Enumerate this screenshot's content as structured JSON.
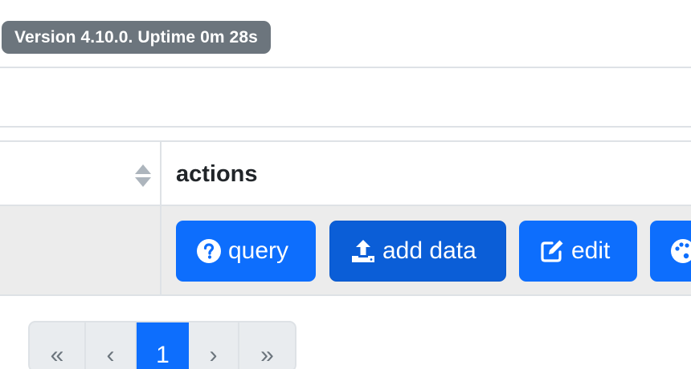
{
  "status": {
    "version_text": "Version 4.10.0. Uptime 0m 28s"
  },
  "table": {
    "columns": [
      {
        "label": "",
        "sortable": true,
        "icon": "sort-icon"
      },
      {
        "label": "actions"
      }
    ],
    "row": {
      "actions": [
        {
          "label": "query",
          "icon": "question-circle-icon",
          "active": false
        },
        {
          "label": "add data",
          "icon": "upload-icon",
          "active": true
        },
        {
          "label": "edit",
          "icon": "edit-icon",
          "active": false
        },
        {
          "label": "",
          "icon": "palette-icon",
          "active": false
        }
      ]
    }
  },
  "pagination": {
    "first": "«",
    "prev": "‹",
    "current": "1",
    "next": "›",
    "last": "»"
  },
  "colors": {
    "primary": "#0d6efd",
    "primary_active": "#0b5ed7",
    "badge_bg": "#6c757d",
    "row_bg": "#ececec",
    "border": "#dee2e6"
  }
}
